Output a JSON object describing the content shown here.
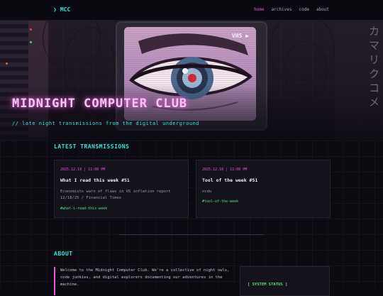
{
  "nav": {
    "brand": "MCC",
    "links": [
      {
        "label": "home",
        "active": true
      },
      {
        "label": "archives",
        "active": false
      },
      {
        "label": "code",
        "active": false
      },
      {
        "label": "about",
        "active": false
      }
    ]
  },
  "hero": {
    "title": "MIDNIGHT COMPUTER CLUB",
    "subtitle": "// late night transmissions from the digital underground",
    "monitor_label": "VHS ▶",
    "katakana": "カマリクコメ"
  },
  "transmissions": {
    "heading": "LATEST TRANSMISSIONS",
    "posts": [
      {
        "date": "2025.12.19 | 11:00 PM",
        "title": "What I read this week #51",
        "excerpt": "Economists warn of flaws in US inflation report 12/18/25 / Financial Times",
        "tag": "#what-i-read-this-week"
      },
      {
        "date": "2025.12.16 | 11:00 PM",
        "title": "Tool of the week #51",
        "excerpt": "ncdu",
        "tag": "#tool-of-the-week"
      }
    ]
  },
  "about": {
    "heading": "ABOUT",
    "text": "Welcome to the Midnight Computer Club. We're a collective of night owls, code junkies, and digital explorers documenting our adventures in the machine.",
    "status_label": "[ SYSTEM STATUS ]"
  },
  "colors": {
    "accent_cyan": "#2ee6d6",
    "accent_magenta": "#e45ad6",
    "accent_green": "#5ce07a",
    "background": "#0d0b12"
  }
}
